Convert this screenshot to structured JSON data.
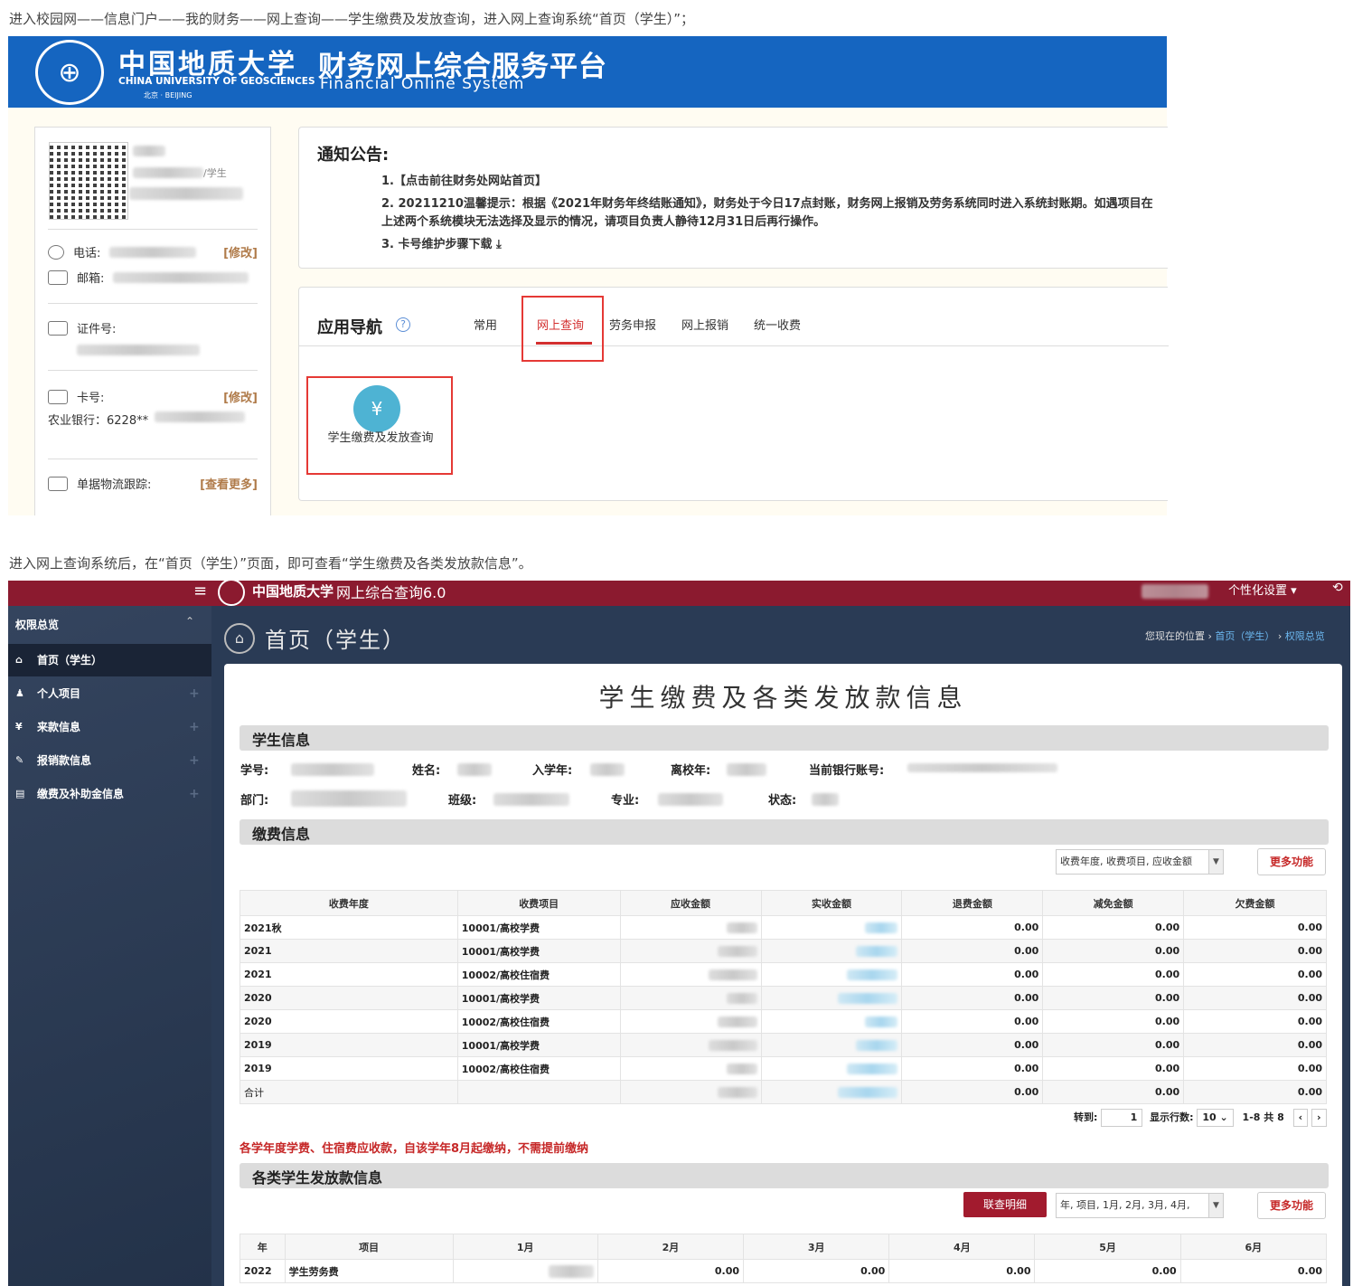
{
  "captions": {
    "top": "进入校园网——信息门户——我的财务——网上查询——学生缴费及发放查询，进入网上查询系统“首页（学生）”；",
    "bottom": "进入网上查询系统后，在“首页（学生）”页面，即可查看“学生缴费及各类发放款信息”。"
  },
  "fin_header": {
    "logo_cn": "中国地质大学",
    "logo_en": "CHINA UNIVERSITY OF GEOSCIENCES",
    "logo_city": "北京 · BEIJING",
    "title": "财务网上综合服务平台",
    "subtitle": "Financial Online System"
  },
  "user_card": {
    "role": "/学生",
    "phone_label": "电话:",
    "email_label": "邮箱:",
    "id_label": "证件号:",
    "card_label": "卡号:",
    "card_value": "农业银行：6228**",
    "edit_label": "[修改]",
    "tracking_label": "单据物流跟踪:",
    "more_label": "[查看更多]"
  },
  "notice": {
    "title": "通知公告:",
    "items": [
      "1.【点击前往财务处网站首页】",
      "2. 20211210温馨提示：根据《2021年财务年终结账通知》，财务处于今日17点封账，财务网上报销及劳务系统同时进入系统封账期。如遇项目在上述两个系统模块无法选择及显示的情况，请项目负责人静待12月31日后再行操作。",
      "3. 卡号维护步骤下载"
    ]
  },
  "app_nav": {
    "title": "应用导航",
    "tabs": [
      "常用",
      "网上查询",
      "劳务申报",
      "网上报销",
      "统一收费"
    ],
    "app_label": "学生缴费及发放查询",
    "app_icon": "¥"
  },
  "query_header": {
    "title": "网上综合查询6.0",
    "logo_cn": "中国地质大学",
    "settings": "个性化设置 ▾",
    "power": "⟲"
  },
  "sidebar": {
    "head": "权限总览",
    "items": [
      {
        "icon": "⌂",
        "label": "首页（学生）"
      },
      {
        "icon": "♟",
        "label": "个人项目"
      },
      {
        "icon": "¥",
        "label": "来款信息"
      },
      {
        "icon": "✎",
        "label": "报销款信息"
      },
      {
        "icon": "▤",
        "label": "缴费及补助金信息"
      }
    ]
  },
  "page": {
    "title": "首页（学生）",
    "crumb_prefix": "您现在的位置 ›",
    "crumb_1": "首页（学生）",
    "crumb_sep": " › ",
    "crumb_2": "权限总览",
    "panel_title": "学生缴费及各类发放款信息"
  },
  "student_info": {
    "title": "学生信息",
    "labels": {
      "xh": "学号:",
      "xm": "姓名:",
      "rxn": "入学年:",
      "lxn": "离校年:",
      "yhzh": "当前银行账号:",
      "bm": "部门:",
      "bj": "班级:",
      "zy": "专业:",
      "zt": "状态:"
    }
  },
  "fee_info": {
    "title": "缴费信息",
    "combo": "收费年度, 收费项目, 应收金额",
    "more": "更多功能",
    "headers": [
      "收费年度",
      "收费项目",
      "应收金额",
      "实收金额",
      "退费金额",
      "减免金额",
      "欠费金额"
    ],
    "rows": [
      {
        "year": "2021秋",
        "item": "10001/高校学费",
        "tf": "0.00",
        "jm": "0.00",
        "qf": "0.00"
      },
      {
        "year": "2021",
        "item": "10001/高校学费",
        "tf": "0.00",
        "jm": "0.00",
        "qf": "0.00"
      },
      {
        "year": "2021",
        "item": "10002/高校住宿费",
        "tf": "0.00",
        "jm": "0.00",
        "qf": "0.00"
      },
      {
        "year": "2020",
        "item": "10001/高校学费",
        "tf": "0.00",
        "jm": "0.00",
        "qf": "0.00"
      },
      {
        "year": "2020",
        "item": "10002/高校住宿费",
        "tf": "0.00",
        "jm": "0.00",
        "qf": "0.00"
      },
      {
        "year": "2019",
        "item": "10001/高校学费",
        "tf": "0.00",
        "jm": "0.00",
        "qf": "0.00"
      },
      {
        "year": "2019",
        "item": "10002/高校住宿费",
        "tf": "0.00",
        "jm": "0.00",
        "qf": "0.00"
      },
      {
        "year": "合计",
        "item": "",
        "tf": "0.00",
        "jm": "0.00",
        "qf": "0.00"
      }
    ],
    "pager": {
      "goto": "转到:",
      "page": "1",
      "rows_label": "显示行数:",
      "rows": "10 ⌄",
      "range": "1-8 共 8",
      "prev": "‹",
      "next": "›"
    },
    "note": "各学年度学费、住宿费应收款，自该学年8月起缴纳，不需提前缴纳"
  },
  "payout_info": {
    "title": "各类学生发放款信息",
    "detail_btn": "联查明细",
    "combo": "年, 项目, 1月, 2月, 3月, 4月,",
    "more": "更多功能",
    "headers": [
      "年",
      "项目",
      "1月",
      "2月",
      "3月",
      "4月",
      "5月",
      "6月"
    ],
    "row": {
      "year": "2022",
      "item": "学生劳务费",
      "m2": "0.00",
      "m3": "0.00",
      "m4": "0.00",
      "m5": "0.00",
      "m6": "0.00"
    }
  }
}
